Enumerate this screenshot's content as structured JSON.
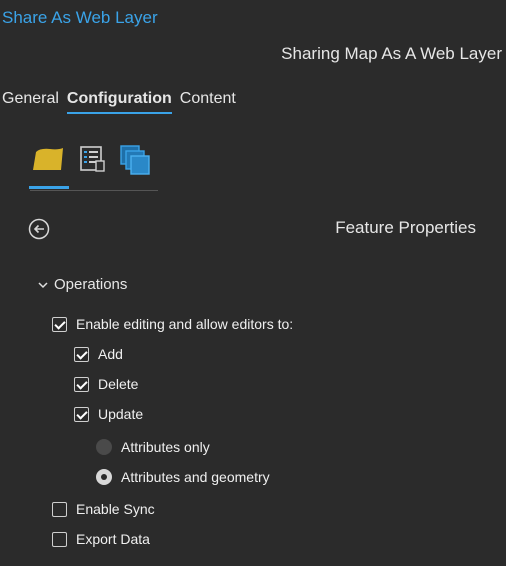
{
  "window": {
    "title": "Share As Web Layer",
    "subtitle": "Sharing Map As A Web Layer"
  },
  "tabs": [
    {
      "label": "General",
      "active": false
    },
    {
      "label": "Configuration",
      "active": true
    },
    {
      "label": "Content",
      "active": false
    }
  ],
  "icon_tabs": [
    {
      "icon": "layer-icon",
      "selected": true
    },
    {
      "icon": "properties-list-icon",
      "selected": false
    },
    {
      "icon": "stacked-layers-icon",
      "selected": false
    }
  ],
  "panel": {
    "back_icon": "back-arrow-icon",
    "title": "Feature Properties"
  },
  "operations": {
    "header": "Operations",
    "enable_editing": {
      "label": "Enable editing and allow editors to:",
      "checked": true
    },
    "add": {
      "label": "Add",
      "checked": true
    },
    "delete": {
      "label": "Delete",
      "checked": true
    },
    "update": {
      "label": "Update",
      "checked": true
    },
    "attributes_only": {
      "label": "Attributes only",
      "selected": false
    },
    "attributes_and_geometry": {
      "label": "Attributes and geometry",
      "selected": true
    },
    "enable_sync": {
      "label": "Enable Sync",
      "checked": false
    },
    "export_data": {
      "label": "Export Data",
      "checked": false
    }
  },
  "colors": {
    "background": "#2b2b2b",
    "accent": "#3aa3e8",
    "layer_icon": "#d9b32a"
  }
}
